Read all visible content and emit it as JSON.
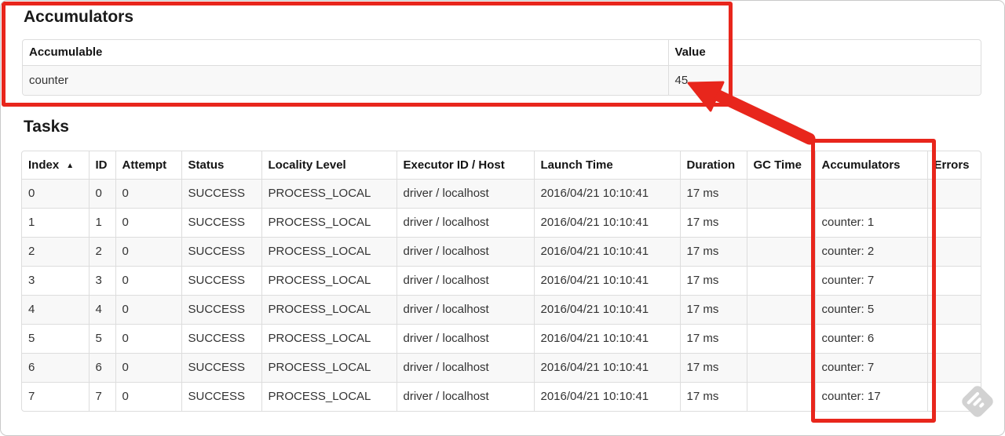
{
  "page": {
    "accumulators": {
      "heading": "Accumulators",
      "table": {
        "columns": [
          "Accumulable",
          "Value"
        ],
        "rows": [
          [
            "counter",
            "45"
          ]
        ]
      }
    },
    "tasks": {
      "heading": "Tasks",
      "table": {
        "columns": [
          "Index",
          "ID",
          "Attempt",
          "Status",
          "Locality Level",
          "Executor ID / Host",
          "Launch Time",
          "Duration",
          "GC Time",
          "Accumulators",
          "Errors"
        ],
        "sort_column": "Index",
        "sort_icon": "▲",
        "rows": [
          [
            "0",
            "0",
            "0",
            "SUCCESS",
            "PROCESS_LOCAL",
            "driver / localhost",
            "2016/04/21 10:10:41",
            "17 ms",
            "",
            "",
            ""
          ],
          [
            "1",
            "1",
            "0",
            "SUCCESS",
            "PROCESS_LOCAL",
            "driver / localhost",
            "2016/04/21 10:10:41",
            "17 ms",
            "",
            "counter: 1",
            ""
          ],
          [
            "2",
            "2",
            "0",
            "SUCCESS",
            "PROCESS_LOCAL",
            "driver / localhost",
            "2016/04/21 10:10:41",
            "17 ms",
            "",
            "counter: 2",
            ""
          ],
          [
            "3",
            "3",
            "0",
            "SUCCESS",
            "PROCESS_LOCAL",
            "driver / localhost",
            "2016/04/21 10:10:41",
            "17 ms",
            "",
            "counter: 7",
            ""
          ],
          [
            "4",
            "4",
            "0",
            "SUCCESS",
            "PROCESS_LOCAL",
            "driver / localhost",
            "2016/04/21 10:10:41",
            "17 ms",
            "",
            "counter: 5",
            ""
          ],
          [
            "5",
            "5",
            "0",
            "SUCCESS",
            "PROCESS_LOCAL",
            "driver / localhost",
            "2016/04/21 10:10:41",
            "17 ms",
            "",
            "counter: 6",
            ""
          ],
          [
            "6",
            "6",
            "0",
            "SUCCESS",
            "PROCESS_LOCAL",
            "driver / localhost",
            "2016/04/21 10:10:41",
            "17 ms",
            "",
            "counter: 7",
            ""
          ],
          [
            "7",
            "7",
            "0",
            "SUCCESS",
            "PROCESS_LOCAL",
            "driver / localhost",
            "2016/04/21 10:10:41",
            "17 ms",
            "",
            "counter: 17",
            ""
          ]
        ]
      }
    },
    "annotations": {
      "highlight_color": "#e8261c",
      "watermark_icon": "skitch-watermark-icon"
    }
  }
}
